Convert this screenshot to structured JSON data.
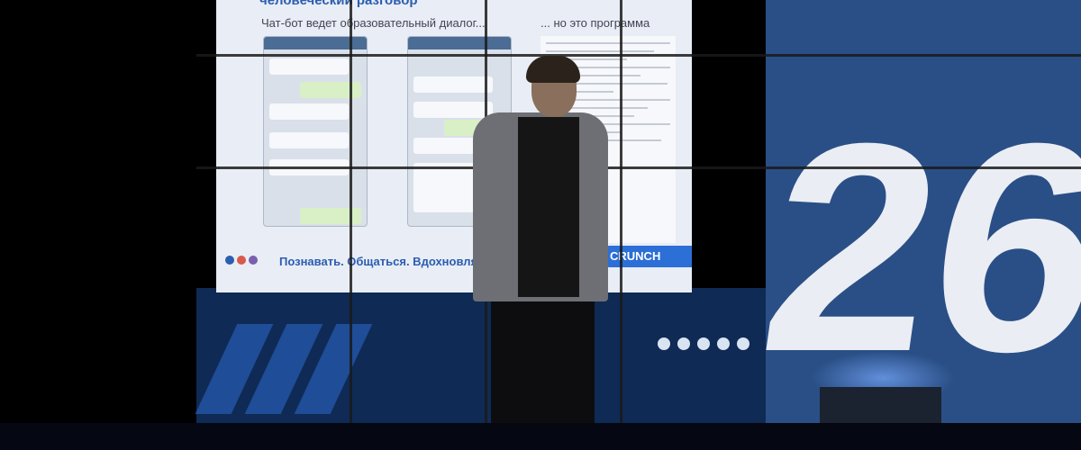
{
  "slide": {
    "title": "человеческий разговор",
    "subtitle_left": "Чат-бот ведет образовательный диалог...",
    "subtitle_right": "... но это программа",
    "tagline": "Познавать. Общаться. Вдохновлять.",
    "badge": "CRUNCH"
  },
  "stage": {
    "event_number": "26"
  },
  "colors": {
    "slide_accent": "#2b5db0",
    "stage_blue": "#2a4f86",
    "badge_blue": "#2c6fd6"
  }
}
